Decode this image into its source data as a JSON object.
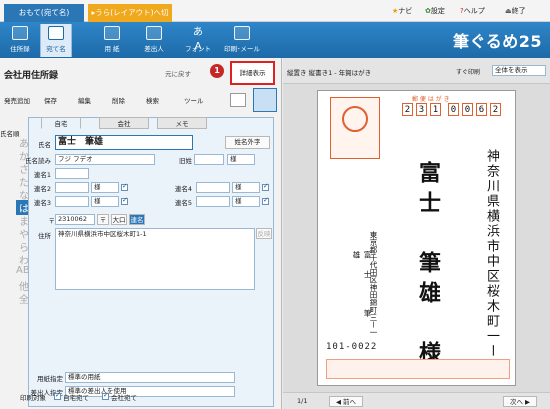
{
  "topbar": {
    "tab_front": "おもて(宛て名)",
    "tab_back": "▸うら(レイアウト)へ切替",
    "navi": "ナビ",
    "settings": "設定",
    "help": "ヘルプ",
    "exit": "終了"
  },
  "ribbon": {
    "items": [
      "住所録",
      "宛て名",
      "用 紙",
      "差出人",
      "フォント",
      "印刷･メール"
    ],
    "brand": "筆ぐるめ25"
  },
  "left": {
    "title": "会社用住所録",
    "back": "元に戻す",
    "detail": "詳細表示",
    "callout": "1",
    "toolbar": [
      "発売追加",
      "保存",
      "編集",
      "削除",
      "検索",
      "ツール"
    ],
    "sort": "氏名順",
    "kana": [
      "あ",
      "か",
      "さ",
      "た",
      "な",
      "は",
      "ま",
      "や",
      "ら",
      "わ",
      "ABC",
      "他",
      "全"
    ],
    "tabs": [
      "自宅",
      "会社",
      "メモ"
    ],
    "name_label": "氏名",
    "name": "富士　筆雄",
    "gaiji": "姓名外字",
    "reading_label": "氏名読み",
    "reading": "フジ フデオ",
    "former_label": "旧姓",
    "form_suffix": "様",
    "joint_labels": [
      "連名1",
      "連名2",
      "連名3",
      "連名4",
      "連名5"
    ],
    "postal_label": "〒",
    "postal": "2310062",
    "postal_btn": "〒",
    "daikoji": "大口",
    "renmei_btn": "連名",
    "address_label": "住所",
    "address": "神奈川県横浜市中区桜木町1-1",
    "address_btn": "反映",
    "paper_label": "用紙指定",
    "paper": "標準の用紙",
    "sender_label": "差出人指定",
    "sender": "標準の差出人を使用",
    "print_label": "印刷対象",
    "print_home": "自宅宛て",
    "print_company": "会社宛て"
  },
  "preview": {
    "header": "縦置き 縦書き1 - 年賀はがき",
    "print_opt": "すぐ印刷",
    "print_select": "全体を表示",
    "card_title": "郵 便 は が き",
    "postal_digits": [
      "2",
      "3",
      "1",
      "0",
      "0",
      "6",
      "2"
    ],
    "address": "神奈川県横浜市中区桜木町一ー一",
    "name": "富士　筆雄　様",
    "sender_address": "東京都千代田区神田錦町三ー一",
    "sender_name": "富士　筆雄",
    "sender_postal": "101-0022",
    "footer_page": "1/1",
    "prev": "◀ 前へ",
    "next": "次へ ▶"
  },
  "colors": {
    "accent": "#2b76b5",
    "callout": "#c62828",
    "stamp": "#e06030"
  }
}
